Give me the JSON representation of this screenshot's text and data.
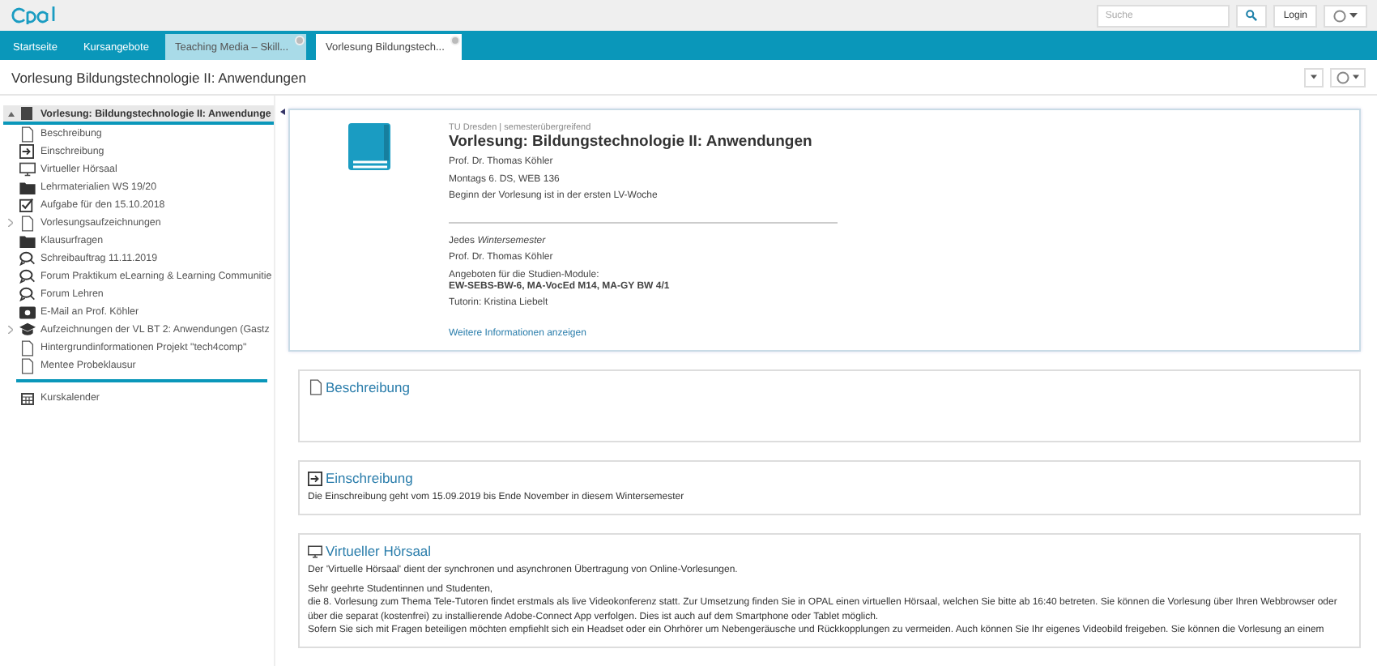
{
  "header": {
    "search": {
      "placeholder": "Suche"
    },
    "login": "Login"
  },
  "tabs": [
    {
      "label": "Startseite",
      "selected": false,
      "closable": false
    },
    {
      "label": "Kursangebote",
      "selected": false,
      "closable": false
    },
    {
      "label": "Teaching Media – Skill...",
      "selected": false,
      "closable": true
    },
    {
      "label": "Vorlesung Bildungstech...",
      "selected": true,
      "closable": true
    }
  ],
  "page_title": "Vorlesung Bildungstechnologie II: Anwendungen",
  "sidebar": {
    "root": {
      "label": "Vorlesung: Bildungstechnologie II: Anwendunge",
      "expanded": true,
      "selected": true
    },
    "items": [
      {
        "label": "Beschreibung",
        "kind": "doc",
        "expandable": false
      },
      {
        "label": "Einschreibung",
        "kind": "enroll",
        "expandable": false
      },
      {
        "label": "Virtueller Hörsaal",
        "kind": "monitor",
        "expandable": false
      },
      {
        "label": "Lehrmaterialien WS 19/20",
        "kind": "folder",
        "expandable": false
      },
      {
        "label": "Aufgabe für den 15.10.2018",
        "kind": "task",
        "expandable": false
      },
      {
        "label": "Vorlesungsaufzeichnungen",
        "kind": "doc",
        "expandable": true
      },
      {
        "label": "Klausurfragen",
        "kind": "folder",
        "expandable": false
      },
      {
        "label": "Schreibauftrag 11.11.2019",
        "kind": "forum",
        "expandable": false
      },
      {
        "label": "Forum Praktikum eLearning & Learning Communitie",
        "kind": "forum",
        "expandable": false
      },
      {
        "label": "Forum Lehren",
        "kind": "forum",
        "expandable": false
      },
      {
        "label": "E-Mail an Prof. Köhler",
        "kind": "mail",
        "expandable": false
      },
      {
        "label": "Aufzeichnungen der VL BT 2: Anwendungen (Gastz",
        "kind": "course",
        "expandable": true
      },
      {
        "label": "Hintergrundinformationen Projekt \"tech4comp\"",
        "kind": "doc",
        "expandable": false
      },
      {
        "label": "Mentee Probeklausur",
        "kind": "doc",
        "expandable": false
      }
    ],
    "calendar": "Kurskalender"
  },
  "info": {
    "org": "TU Dresden | semesterübergreifend",
    "title": "Vorlesung: Bildungstechnologie II: Anwendungen",
    "lines_top": [
      "Prof. Dr. Thomas Köhler",
      "Montags 6. DS, WEB 136",
      "Beginn der Vorlesung ist in der ersten LV-Woche"
    ],
    "lines_bottom": [
      "Jedes *Wintersemester*",
      "Prof. Dr. Thomas Köhler",
      "Angeboten für die Studien-Module:\n**EW-SEBS-BW-6, MA-VocEd M14, MA-GY BW 4/1**",
      "Tutorin: Kristina Liebelt"
    ],
    "more_link": "Weitere Informationen anzeigen"
  },
  "sections": [
    {
      "title": "Beschreibung",
      "kind": "doc"
    },
    {
      "title": "Einschreibung",
      "kind": "enroll",
      "paragraphs": [
        "Die Einschreibung geht vom 15.09.2019 bis Ende November in diesem Wintersemester"
      ]
    },
    {
      "title": "Virtueller Hörsaal",
      "kind": "monitor",
      "paragraphs": [
        "Der 'Virtuelle Hörsaal' dient der synchronen und asynchronen Übertragung von Online-Vorlesungen.",
        "Sehr geehrte Studentinnen und Studenten,\ndie 8. Vorlesung zum Thema Tele-Tutoren findet erstmals als live Videokonferenz statt. Zur Umsetzung finden Sie in OPAL einen virtuellen Hörsaal, welchen Sie bitte ab 16:40 betreten. Sie können die Vorlesung über Ihren Webbrowser oder über die separat (kostenfrei) zu installierende Adobe-Connect App verfolgen. Dies ist auch auf dem Smartphone oder Tablet möglich.\nSofern Sie sich mit Fragen beteiligen möchten empfiehlt sich ein Headset oder ein Ohrhörer um Nebengeräusche und Rückkopplungen zu vermeiden. Auch können Sie Ihr eigenes Videobild freigeben. Sie können die Vorlesung an einem"
      ]
    }
  ]
}
